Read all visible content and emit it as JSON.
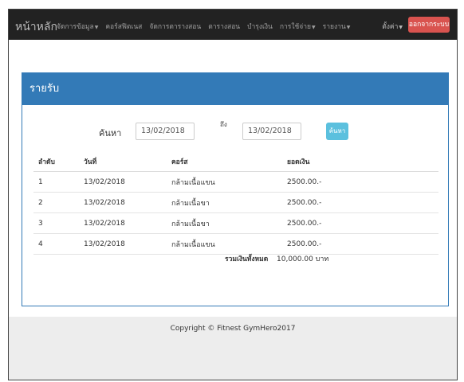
{
  "navbar": {
    "brand": "หน้าหลัก",
    "items": [
      {
        "label": "จัดการข้อมูล",
        "caret": true
      },
      {
        "label": "คอร์สฟิตเนส",
        "caret": false
      },
      {
        "label": "จัดการตารางสอน",
        "caret": false
      },
      {
        "label": "ตารางสอน",
        "caret": false
      },
      {
        "label": "บำรุงเงิน",
        "caret": false
      },
      {
        "label": "การใช้จ่าย",
        "caret": true
      },
      {
        "label": "รายงาน",
        "caret": true
      }
    ],
    "user_menu": "ตั้งค่า",
    "logout": "ออกจากระบบ"
  },
  "panel": {
    "title": "รายรับ",
    "search_label": "ค้นหา",
    "from_date": "13/02/2018",
    "to_label": "ถึง",
    "to_date": "13/02/2018",
    "search_button": "ค้นหา"
  },
  "table": {
    "headers": [
      "ลำดับ",
      "วันที่",
      "คอร์ส",
      "ยอดเงิน"
    ],
    "rows": [
      [
        "1",
        "13/02/2018",
        "กล้ามเนื้อแขน",
        "2500.00.-"
      ],
      [
        "2",
        "13/02/2018",
        "กล้ามเนื้อขา",
        "2500.00.-"
      ],
      [
        "3",
        "13/02/2018",
        "กล้ามเนื้อขา",
        "2500.00.-"
      ],
      [
        "4",
        "13/02/2018",
        "กล้ามเนื้อแขน",
        "2500.00.-"
      ]
    ],
    "total_label": "รวมเงินทั้งหมด",
    "total_value": "10,000.00  บาท"
  },
  "footer": "Copyright © Fitnest GymHero2017",
  "colors": {
    "navbar": "#222222",
    "panel_heading": "#337ab7",
    "logout_button": "#d9534f",
    "search_button": "#5bc0de"
  }
}
